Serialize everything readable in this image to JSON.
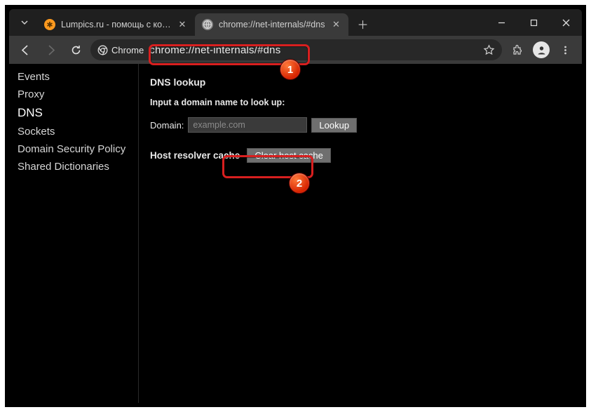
{
  "tabs": {
    "t1_title": "Lumpics.ru - помощь с компью",
    "t2_title": "chrome://net-internals/#dns"
  },
  "toolbar": {
    "chrome_chip": "Chrome",
    "url": "chrome://net-internals/#dns"
  },
  "sidebar": {
    "items": [
      "Events",
      "Proxy",
      "DNS",
      "Sockets",
      "Domain Security Policy",
      "Shared Dictionaries"
    ],
    "selected_index": 2
  },
  "main": {
    "heading": "DNS lookup",
    "hint": "Input a domain name to look up:",
    "domain_label": "Domain:",
    "domain_placeholder": "example.com",
    "lookup_btn": "Lookup",
    "cache_label": "Host resolver cache",
    "clear_btn": "Clear host cache"
  },
  "annotations": {
    "b1": "1",
    "b2": "2"
  }
}
